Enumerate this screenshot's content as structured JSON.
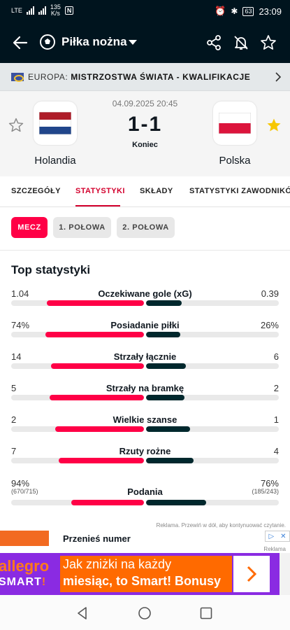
{
  "status_bar": {
    "network": "LTE",
    "speed_value": "135",
    "speed_unit": "K/s",
    "nfc": "N",
    "battery": "63",
    "time": "23:09"
  },
  "app_bar": {
    "title": "Piłka nożna"
  },
  "league": {
    "country": "EUROPA:",
    "name": "MISTRZOSTWA ŚWIATA - KWALIFIKACJE"
  },
  "match": {
    "date": "04.09.2025 20:45",
    "score": "1-1",
    "status": "Koniec",
    "home": {
      "name": "Holandia"
    },
    "away": {
      "name": "Polska"
    }
  },
  "tabs": [
    "SZCZEGÓŁY",
    "STATYSTYKI",
    "SKŁADY",
    "STATYSTYKI ZAWODNIKÓW"
  ],
  "subtabs": [
    "MECZ",
    "1. POŁOWA",
    "2. POŁOWA"
  ],
  "section_title": "Top statystyki",
  "stats": [
    {
      "label": "Oczekiwane gole (xG)",
      "home": "1.04",
      "away": "0.39",
      "home_share": 0.73,
      "away_share": 0.27
    },
    {
      "label": "Posiadanie piłki",
      "home": "74%",
      "away": "26%",
      "home_share": 0.74,
      "away_share": 0.26
    },
    {
      "label": "Strzały łącznie",
      "home": "14",
      "away": "6",
      "home_share": 0.7,
      "away_share": 0.3
    },
    {
      "label": "Strzały na bramkę",
      "home": "5",
      "away": "2",
      "home_share": 0.71,
      "away_share": 0.29
    },
    {
      "label": "Wielkie szanse",
      "home": "2",
      "away": "1",
      "home_share": 0.67,
      "away_share": 0.33
    },
    {
      "label": "Rzuty rożne",
      "home": "7",
      "away": "4",
      "home_share": 0.64,
      "away_share": 0.36
    },
    {
      "label": "Podania",
      "home": "94%",
      "away": "76%",
      "home_sub": "(670/715)",
      "away_sub": "(185/243)",
      "home_share": 0.55,
      "away_share": 0.45
    }
  ],
  "ad": {
    "note": "Reklama. Przewiń w dół, aby kontynuować czytanie.",
    "top_text": "Przenieś numer",
    "label": "Reklama",
    "brand": "allegro",
    "brand_sub_1": "SMART",
    "brand_sub_2": "!",
    "line1": "Jak zniżki na każdy",
    "line2": "miesiąc, to Smart! Bonusy"
  },
  "colors": {
    "accent": "#ff0046",
    "dark": "#00141e",
    "away_bar": "#00282d",
    "star": "#f7c700"
  }
}
